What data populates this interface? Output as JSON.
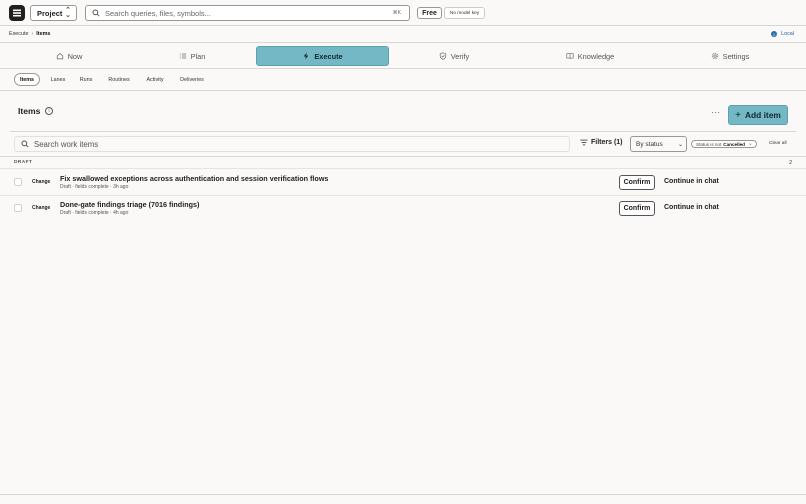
{
  "topbar": {
    "project_label": "Project",
    "search_placeholder": "Search queries, files, symbols...",
    "search_shortcut": "⌘K",
    "plan_badge": "Free",
    "model_key_badge": "No model key"
  },
  "breadcrumb": {
    "parent": "Execute",
    "separator": "›",
    "current": "Items"
  },
  "environment": {
    "label": "Local"
  },
  "nav": {
    "tabs": [
      {
        "label": "Now",
        "icon": "home-icon"
      },
      {
        "label": "Plan",
        "icon": "list-icon"
      },
      {
        "label": "Execute",
        "icon": "bolt-icon",
        "active": true
      },
      {
        "label": "Verify",
        "icon": "shield-check-icon"
      },
      {
        "label": "Knowledge",
        "icon": "book-icon"
      },
      {
        "label": "Settings",
        "icon": "gear-icon"
      }
    ]
  },
  "subnav": {
    "tabs": [
      {
        "label": "Items",
        "active": true
      },
      {
        "label": "Lanes"
      },
      {
        "label": "Runs"
      },
      {
        "label": "Routines"
      },
      {
        "label": "Activity"
      },
      {
        "label": "Deliveries"
      }
    ]
  },
  "items_header": {
    "title": "Items",
    "info": "i",
    "more": "···",
    "add_label": "Add item",
    "add_icon": "+"
  },
  "filters": {
    "search_placeholder": "Search work items",
    "filters_label": "Filters (1)",
    "group_by": "By status",
    "chip_prefix": "Status is not",
    "chip_value": "Cancelled",
    "chip_remove": "×",
    "clear_all": "Clear all"
  },
  "group": {
    "label": "DRAFT",
    "count": "2"
  },
  "items": [
    {
      "change_label": "Change",
      "title": "Fix swallowed exceptions across authentication and session verification flows",
      "meta": "Draft · fields complete · 3h ago",
      "confirm_label": "Confirm",
      "chat_label": "Continue in chat"
    },
    {
      "change_label": "Change",
      "title": "Done-gate findings triage (7016 findings)",
      "meta": "Draft · fields complete · 4h ago",
      "confirm_label": "Confirm",
      "chat_label": "Continue in chat"
    }
  ],
  "colors": {
    "accent": "#74b7c5",
    "local": "#1d5fa8"
  }
}
